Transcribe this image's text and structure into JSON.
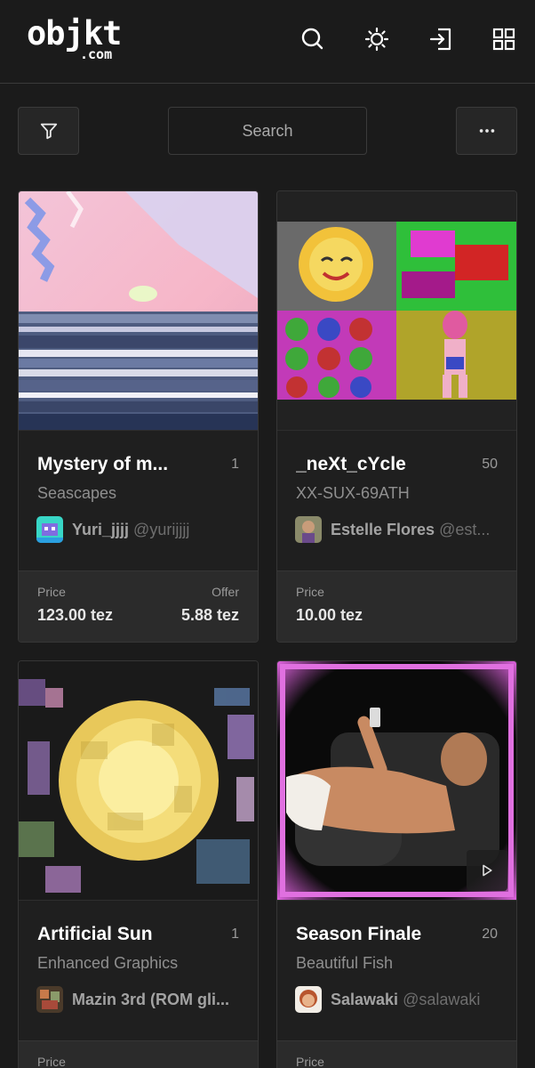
{
  "header": {
    "logo_main": "objkt",
    "logo_sub": ".com",
    "icons": [
      "search-icon",
      "sun-icon",
      "login-icon",
      "grid-icon"
    ]
  },
  "toolbar": {
    "filter_icon": "filter-icon",
    "search_placeholder": "Search",
    "more_icon": "more-icon"
  },
  "cards": [
    {
      "title": "Mystery of m...",
      "edition": "1",
      "collection": "Seascapes",
      "creator_name": "Yuri_jjjj",
      "creator_handle": "@yurijjjj",
      "price_label": "Price",
      "price_value": "123.00 tez",
      "offer_label": "Offer",
      "offer_value": "5.88 tez"
    },
    {
      "title": "_neXt_cYcle",
      "edition": "50",
      "collection": "XX-SUX-69ATH",
      "creator_name": "Estelle Flores",
      "creator_handle": "@est...",
      "price_label": "Price",
      "price_value": "10.00 tez"
    },
    {
      "title": "Artificial Sun",
      "edition": "1",
      "collection": "Enhanced Graphics",
      "creator_name": "Mazin 3rd (ROM gli...",
      "creator_handle": "",
      "price_label": "Price"
    },
    {
      "title": "Season Finale",
      "edition": "20",
      "collection": "Beautiful Fish",
      "creator_name": "Salawaki",
      "creator_handle": "@salawaki",
      "price_label": "Price",
      "play_icon": "play-icon"
    }
  ],
  "colors": {
    "background": "#1b1b1b",
    "card": "#222222",
    "price_panel": "#2b2b2b",
    "text": "#ffffff",
    "muted": "#8f8f8f"
  }
}
